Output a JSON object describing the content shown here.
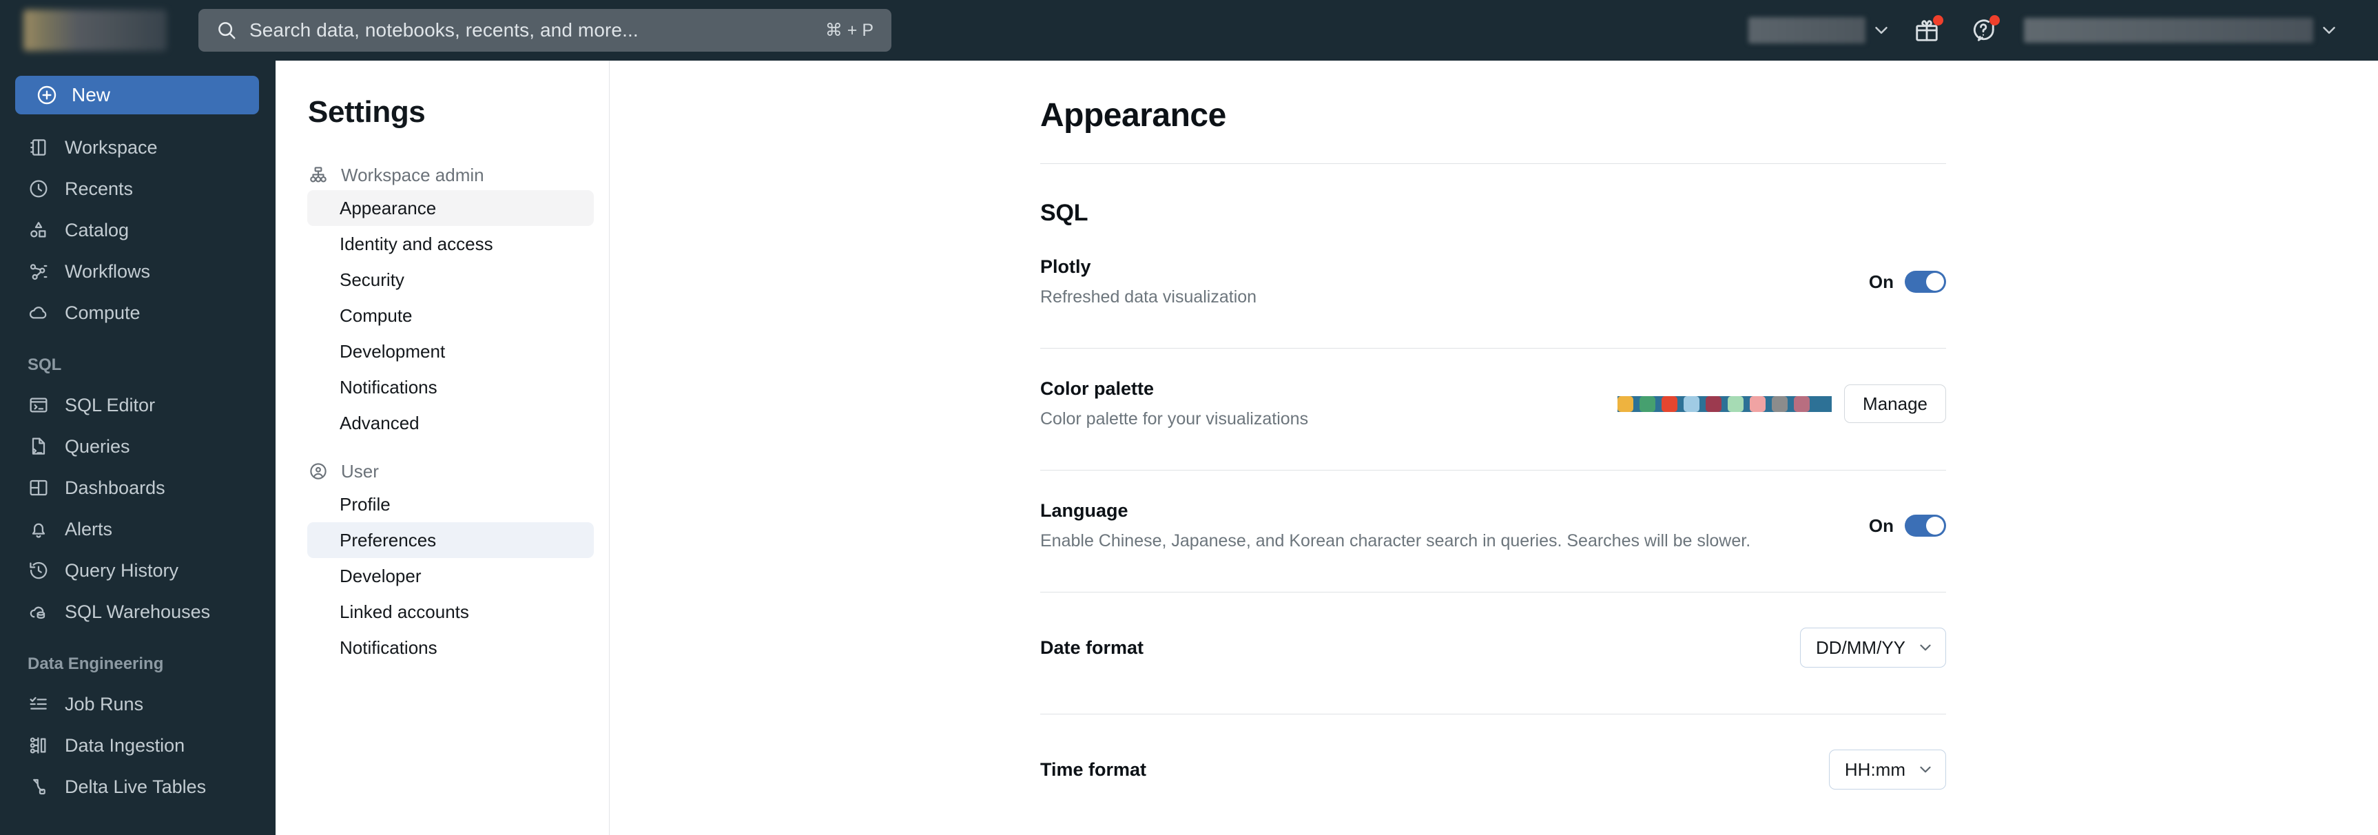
{
  "topbar": {
    "search": {
      "placeholder": "Search data, notebooks, recents, and more...",
      "shortcut": "⌘ + P"
    },
    "gift_icon": "gift-icon",
    "help_icon": "help-question-icon"
  },
  "leftnav": {
    "new_label": "New",
    "items": [
      {
        "label": "Workspace",
        "icon": "workspace-icon"
      },
      {
        "label": "Recents",
        "icon": "clock-icon"
      },
      {
        "label": "Catalog",
        "icon": "catalog-shapes-icon"
      },
      {
        "label": "Workflows",
        "icon": "workflows-icon"
      },
      {
        "label": "Compute",
        "icon": "cloud-icon"
      }
    ],
    "sql_group": "SQL",
    "sql_items": [
      {
        "label": "SQL Editor",
        "icon": "sql-editor-icon"
      },
      {
        "label": "Queries",
        "icon": "query-file-icon"
      },
      {
        "label": "Dashboards",
        "icon": "dashboard-grid-icon"
      },
      {
        "label": "Alerts",
        "icon": "bell-icon"
      },
      {
        "label": "Query History",
        "icon": "history-clock-icon"
      },
      {
        "label": "SQL Warehouses",
        "icon": "warehouse-cloud-icon"
      }
    ],
    "de_group": "Data Engineering",
    "de_items": [
      {
        "label": "Job Runs",
        "icon": "checklist-icon"
      },
      {
        "label": "Data Ingestion",
        "icon": "ingestion-icon"
      },
      {
        "label": "Delta Live Tables",
        "icon": "delta-live-tables-icon"
      }
    ]
  },
  "settings": {
    "title": "Settings",
    "groups": [
      {
        "label": "Workspace admin",
        "icon": "org-chart-icon",
        "items": [
          {
            "label": "Appearance",
            "selected": "grey"
          },
          {
            "label": "Identity and access",
            "selected": ""
          },
          {
            "label": "Security",
            "selected": ""
          },
          {
            "label": "Compute",
            "selected": ""
          },
          {
            "label": "Development",
            "selected": ""
          },
          {
            "label": "Notifications",
            "selected": ""
          },
          {
            "label": "Advanced",
            "selected": ""
          }
        ]
      },
      {
        "label": "User",
        "icon": "user-circle-icon",
        "items": [
          {
            "label": "Profile",
            "selected": ""
          },
          {
            "label": "Preferences",
            "selected": "blue"
          },
          {
            "label": "Developer",
            "selected": ""
          },
          {
            "label": "Linked accounts",
            "selected": ""
          },
          {
            "label": "Notifications",
            "selected": ""
          }
        ]
      }
    ]
  },
  "main": {
    "page_title": "Appearance",
    "section_sql": "SQL",
    "plotly": {
      "label": "Plotly",
      "desc": "Refreshed data visualization",
      "toggle_state": "On"
    },
    "palette": {
      "label": "Color palette",
      "desc": "Color palette for your visualizations",
      "manage_label": "Manage",
      "colors": [
        "#2d7196",
        "#eeb33f",
        "#46a06f",
        "#e5462f",
        "#a0cbe4",
        "#9c3a4f",
        "#a6dbb4",
        "#f0a3a3",
        "#8c8c8c",
        "#b86e80"
      ]
    },
    "language": {
      "label": "Language",
      "desc": "Enable Chinese, Japanese, and Korean character search in queries. Searches will be slower.",
      "toggle_state": "On"
    },
    "date_format": {
      "label": "Date format",
      "value": "DD/MM/YY"
    },
    "time_format": {
      "label": "Time format",
      "value": "HH:mm"
    }
  },
  "colors": {
    "nav_bg": "#1b2b34",
    "accent_blue": "#3b6fb6",
    "badge_red": "#f0402c"
  }
}
